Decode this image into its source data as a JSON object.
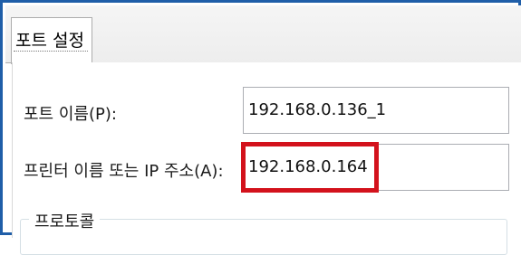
{
  "tabs": [
    {
      "label": "포트 설정"
    }
  ],
  "port_name": {
    "label": "포트 이름(P):",
    "value": "192.168.0.136_1"
  },
  "printer_name": {
    "label": "프린터 이름 또는 IP 주소(A):",
    "value": "192.168.0.164"
  },
  "protocol_group": {
    "title": "프로토콜"
  },
  "colors": {
    "window_border": "#1f5ea8",
    "highlight": "#d3121c",
    "input_border": "#abadb3"
  }
}
